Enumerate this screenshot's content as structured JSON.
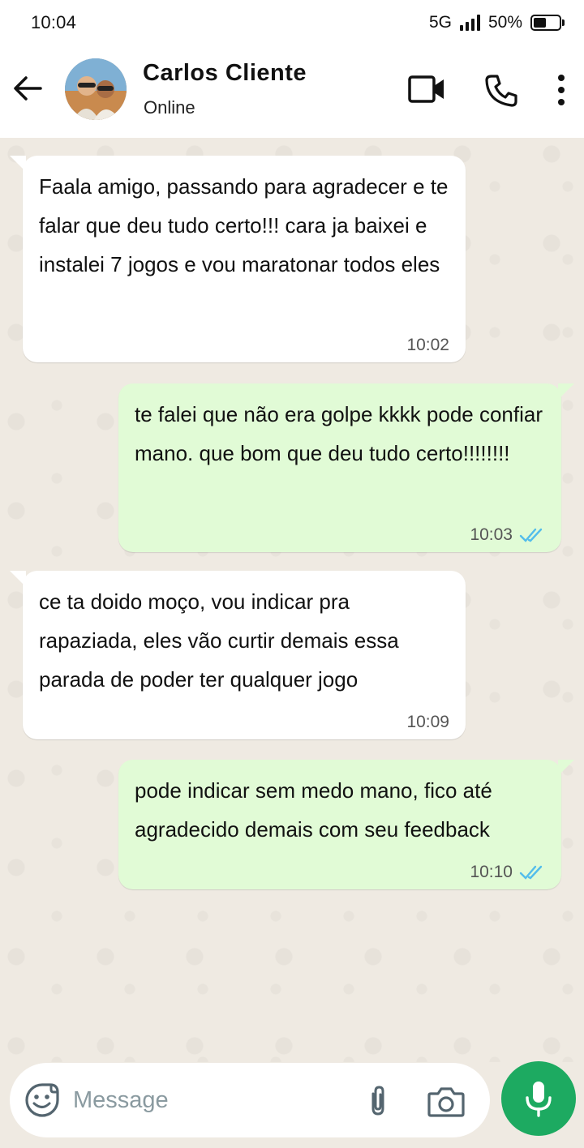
{
  "status_bar": {
    "time": "10:04",
    "network": "5G",
    "battery_percent": "50%",
    "battery_level": 0.5
  },
  "header": {
    "contact_name": "Carlos Cliente",
    "contact_status": "Online",
    "icons": [
      "back-arrow-icon",
      "video-call-icon",
      "phone-icon",
      "more-vert-icon"
    ]
  },
  "messages": [
    {
      "direction": "in",
      "text": "Faala amigo, passando para agradecer e te falar que deu tudo certo!!! cara ja baixei e instalei 7 jogos e vou maratonar todos eles",
      "time": "10:02"
    },
    {
      "direction": "out",
      "text": "te falei que não era golpe kkkk pode confiar mano. que bom que deu tudo certo!!!!!!!!",
      "time": "10:03",
      "status": "read"
    },
    {
      "direction": "in",
      "text": "ce ta doido moço, vou indicar pra rapaziada, eles vão curtir demais essa parada de poder ter qualquer jogo",
      "time": "10:09"
    },
    {
      "direction": "out",
      "text": "pode indicar sem medo mano, fico até agradecido demais com seu feedback",
      "time": "10:10",
      "status": "read"
    }
  ],
  "composer": {
    "placeholder": "Message",
    "icons": [
      "emoji-icon",
      "attach-icon",
      "camera-icon",
      "mic-icon"
    ]
  },
  "colors": {
    "incoming_bubble": "#ffffff",
    "outgoing_bubble": "#e1fbd6",
    "chat_background": "#efeae2",
    "mic_button": "#1daa61",
    "read_ticks": "#53bdeb"
  }
}
